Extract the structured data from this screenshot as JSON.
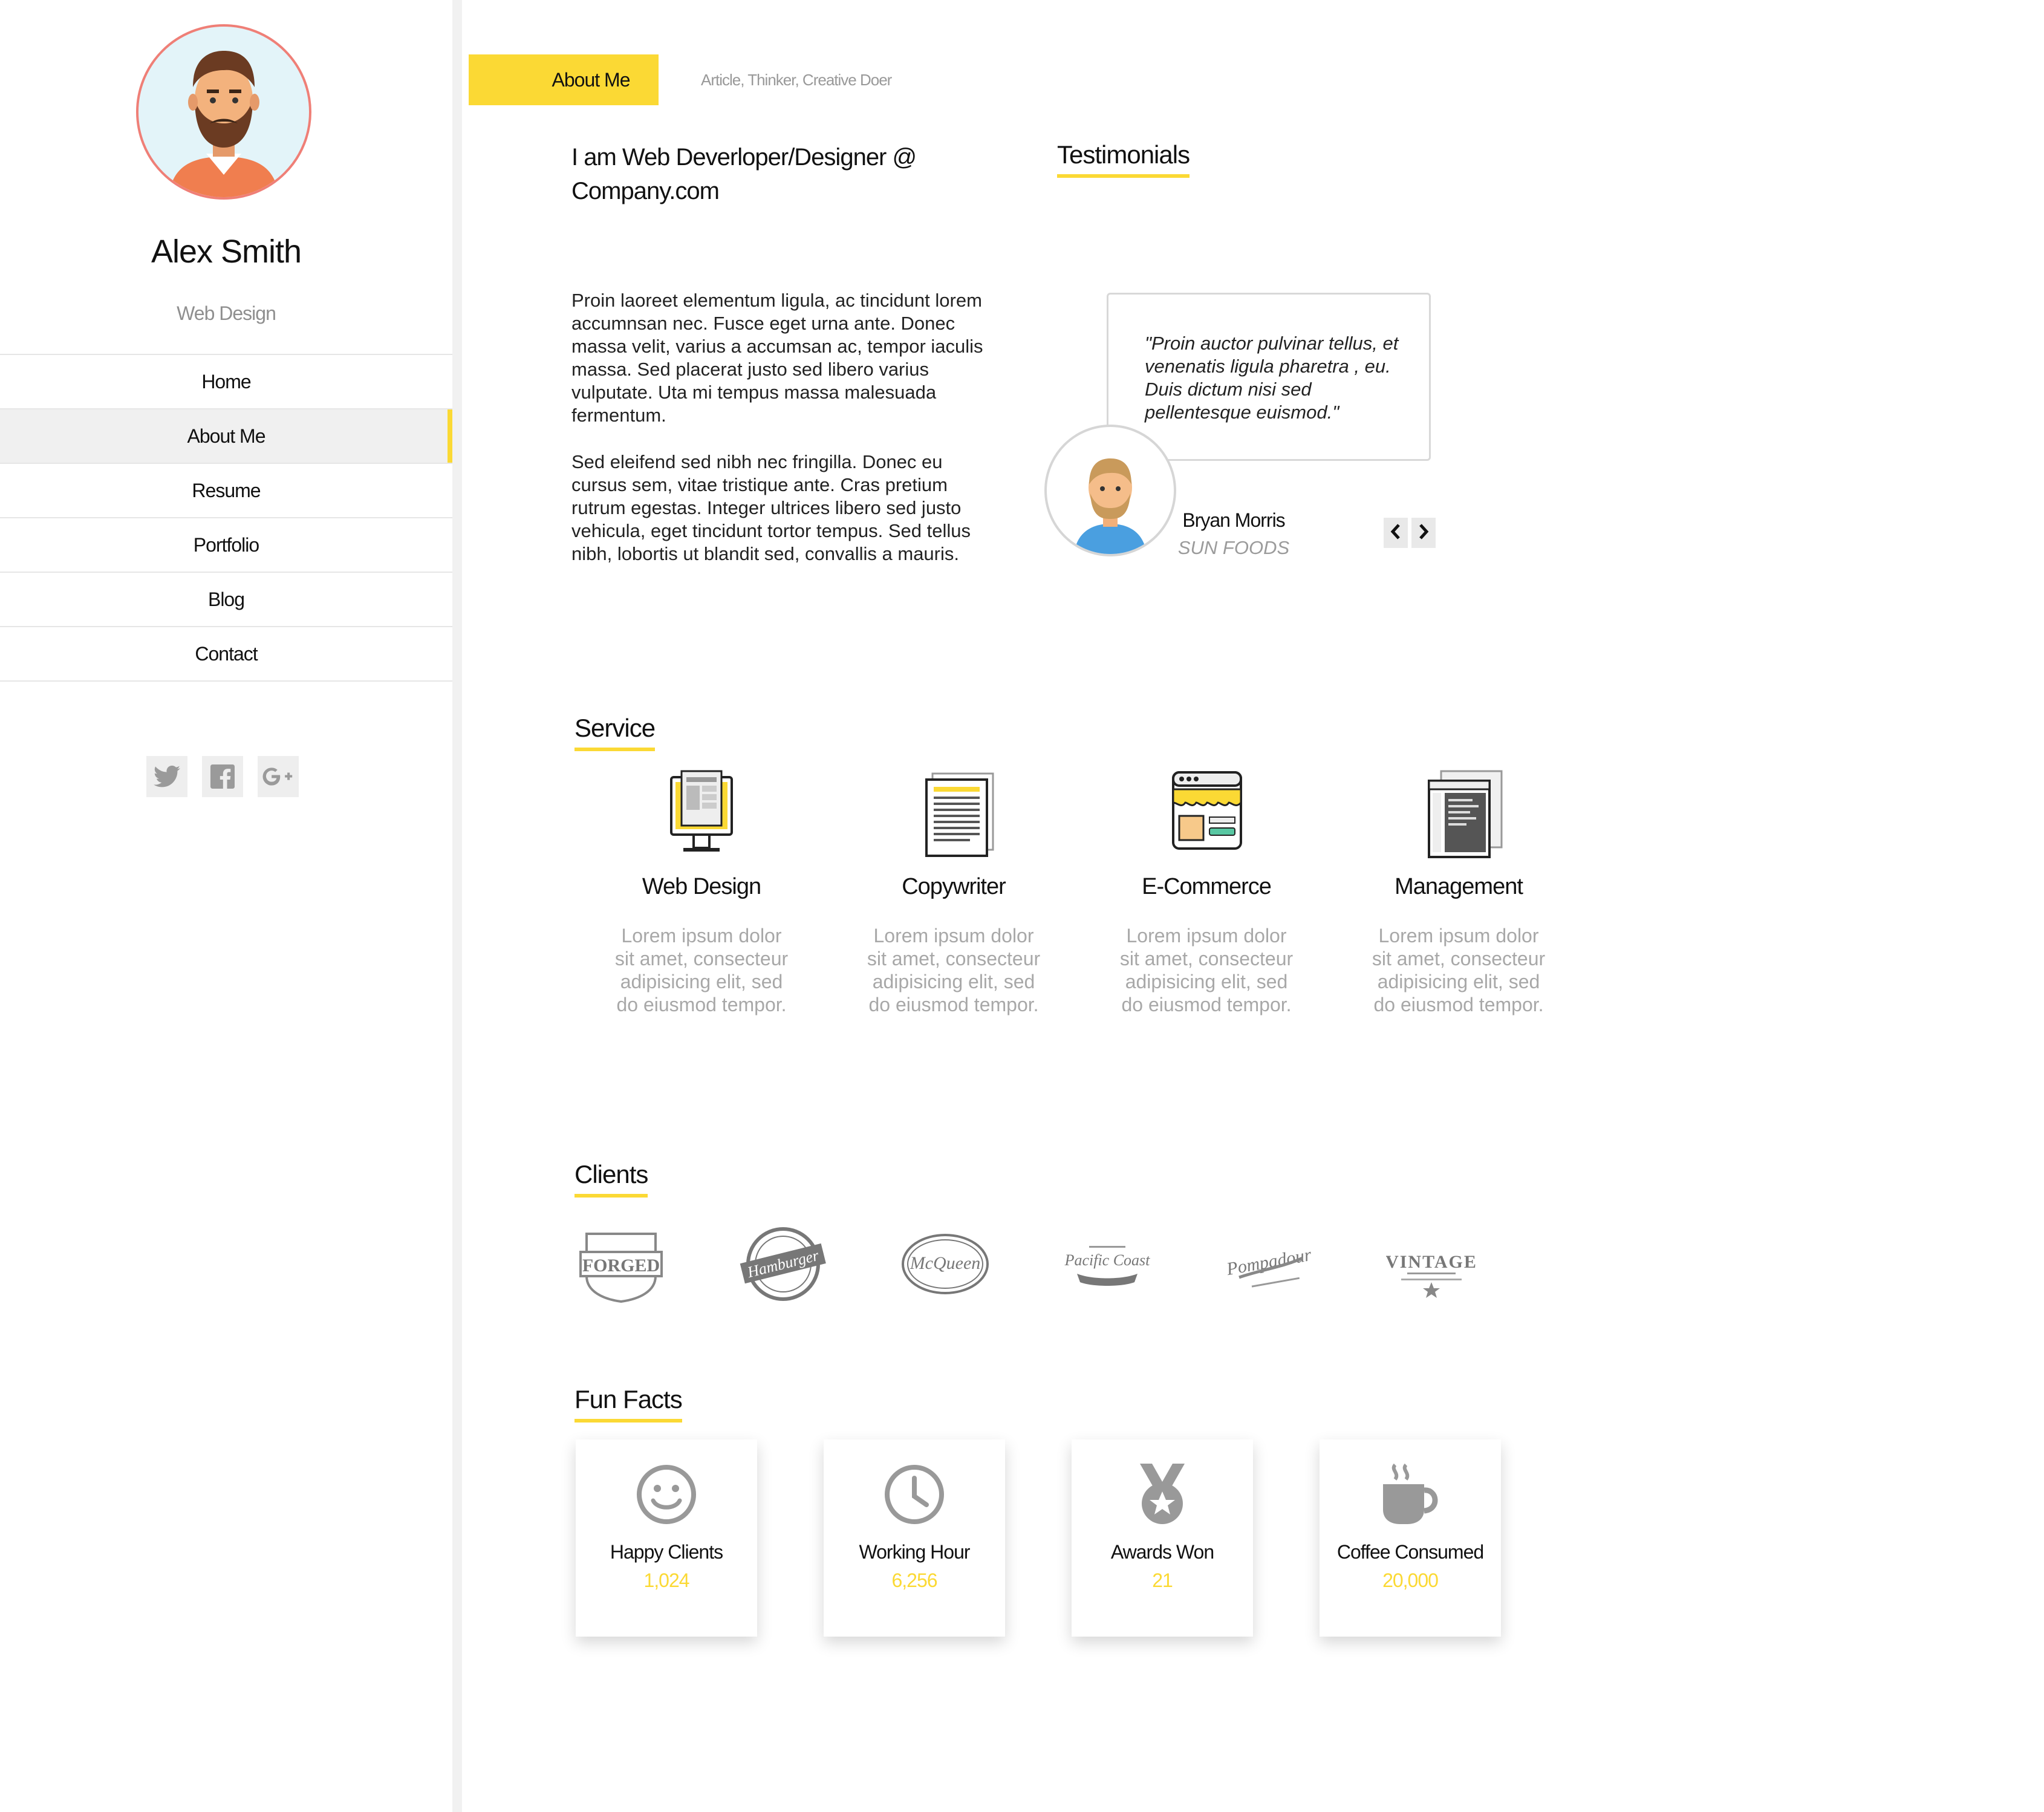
{
  "profile": {
    "name": "Alex Smith",
    "role": "Web Design"
  },
  "nav": [
    {
      "label": "Home"
    },
    {
      "label": "About Me",
      "active": true
    },
    {
      "label": "Resume"
    },
    {
      "label": "Portfolio"
    },
    {
      "label": "Blog"
    },
    {
      "label": "Contact"
    }
  ],
  "social": [
    "twitter-icon",
    "facebook-icon",
    "google-plus-icon"
  ],
  "tab": {
    "active": "About Me",
    "subtitle": "Article, Thinker, Creative Doer"
  },
  "about": {
    "heading": "I am Web Deverloper/Designer @ Company.com",
    "para1": "Proin laoreet elementum ligula, ac tincidunt lorem accumnsan nec. Fusce eget urna ante. Donec massa velit, varius a accumsan ac, tempor iaculis massa. Sed placerat justo sed libero varius vulputate. Uta mi tempus massa malesuada fermentum.",
    "para2": "Sed eleifend sed nibh nec fringilla. Donec eu cursus sem, vitae tristique ante. Cras pretium rutrum egestas. Integer ultrices libero sed justo vehicula, eget tincidunt tortor tempus. Sed tellus nibh, lobortis ut blandit sed, convallis a mauris."
  },
  "testimonials": {
    "heading": "Testimonials",
    "quote": "\"Proin auctor pulvinar tellus, et venenatis ligula pharetra , eu. Duis dictum nisi sed pellentesque euismod.\"",
    "name": "Bryan Morris",
    "company": "SUN FOODS"
  },
  "service": {
    "heading": "Service",
    "items": [
      {
        "title": "Web Design",
        "desc": "Lorem ipsum dolor sit amet, consecteur adipisicing elit, sed do eiusmod tempor.",
        "icon": "monitor-icon"
      },
      {
        "title": "Copywriter",
        "desc": "Lorem ipsum dolor sit amet, consecteur adipisicing elit, sed do eiusmod tempor.",
        "icon": "document-icon"
      },
      {
        "title": "E-Commerce",
        "desc": "Lorem ipsum dolor sit amet, consecteur adipisicing elit, sed do eiusmod tempor.",
        "icon": "storefront-icon"
      },
      {
        "title": "Management",
        "desc": "Lorem ipsum dolor sit amet, consecteur adipisicing elit, sed do eiusmod tempor.",
        "icon": "window-stack-icon"
      }
    ]
  },
  "clients": {
    "heading": "Clients",
    "logos": [
      "FORGED",
      "Hamburger",
      "McQueen",
      "Pacific Coast",
      "Pompadour",
      "VINTAGE"
    ]
  },
  "fun_facts": {
    "heading": "Fun Facts",
    "items": [
      {
        "label": "Happy Clients",
        "value": "1,024",
        "icon": "smiley-icon"
      },
      {
        "label": "Working Hour",
        "value": "6,256",
        "icon": "clock-icon"
      },
      {
        "label": "Awards Won",
        "value": "21",
        "icon": "medal-icon"
      },
      {
        "label": "Coffee Consumed",
        "value": "20,000",
        "icon": "coffee-cup-icon"
      }
    ]
  },
  "colors": {
    "accent": "#fbd934",
    "avatar_ring": "#ef7f77",
    "muted": "#999999"
  }
}
